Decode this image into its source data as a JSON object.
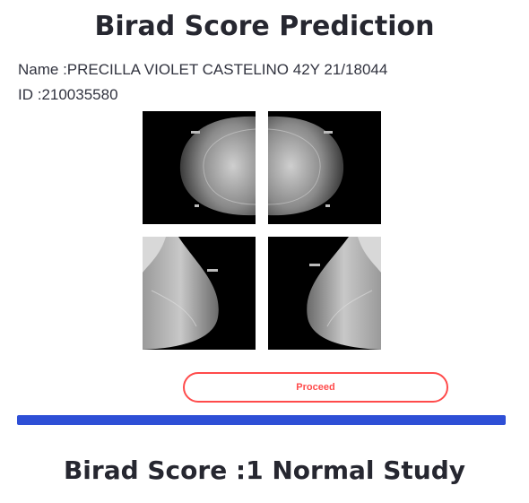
{
  "page": {
    "title": "Birad Score Prediction"
  },
  "patient": {
    "name_label": "Name :PRECILLA VIOLET CASTELINO 42Y 21/18044",
    "id_label": "ID :210035580"
  },
  "images": [
    {
      "view": "right-breast-view-1"
    },
    {
      "view": "left-breast-view-1"
    },
    {
      "view": "right-breast-view-2"
    },
    {
      "view": "left-breast-view-2"
    }
  ],
  "actions": {
    "proceed_label": "Proceed"
  },
  "progress": {
    "percent": 100,
    "color": "#2e4fd6"
  },
  "result": {
    "text": "Birad Score :1 Normal Study"
  },
  "colors": {
    "accent": "#ff4b4b",
    "text": "#262730"
  }
}
